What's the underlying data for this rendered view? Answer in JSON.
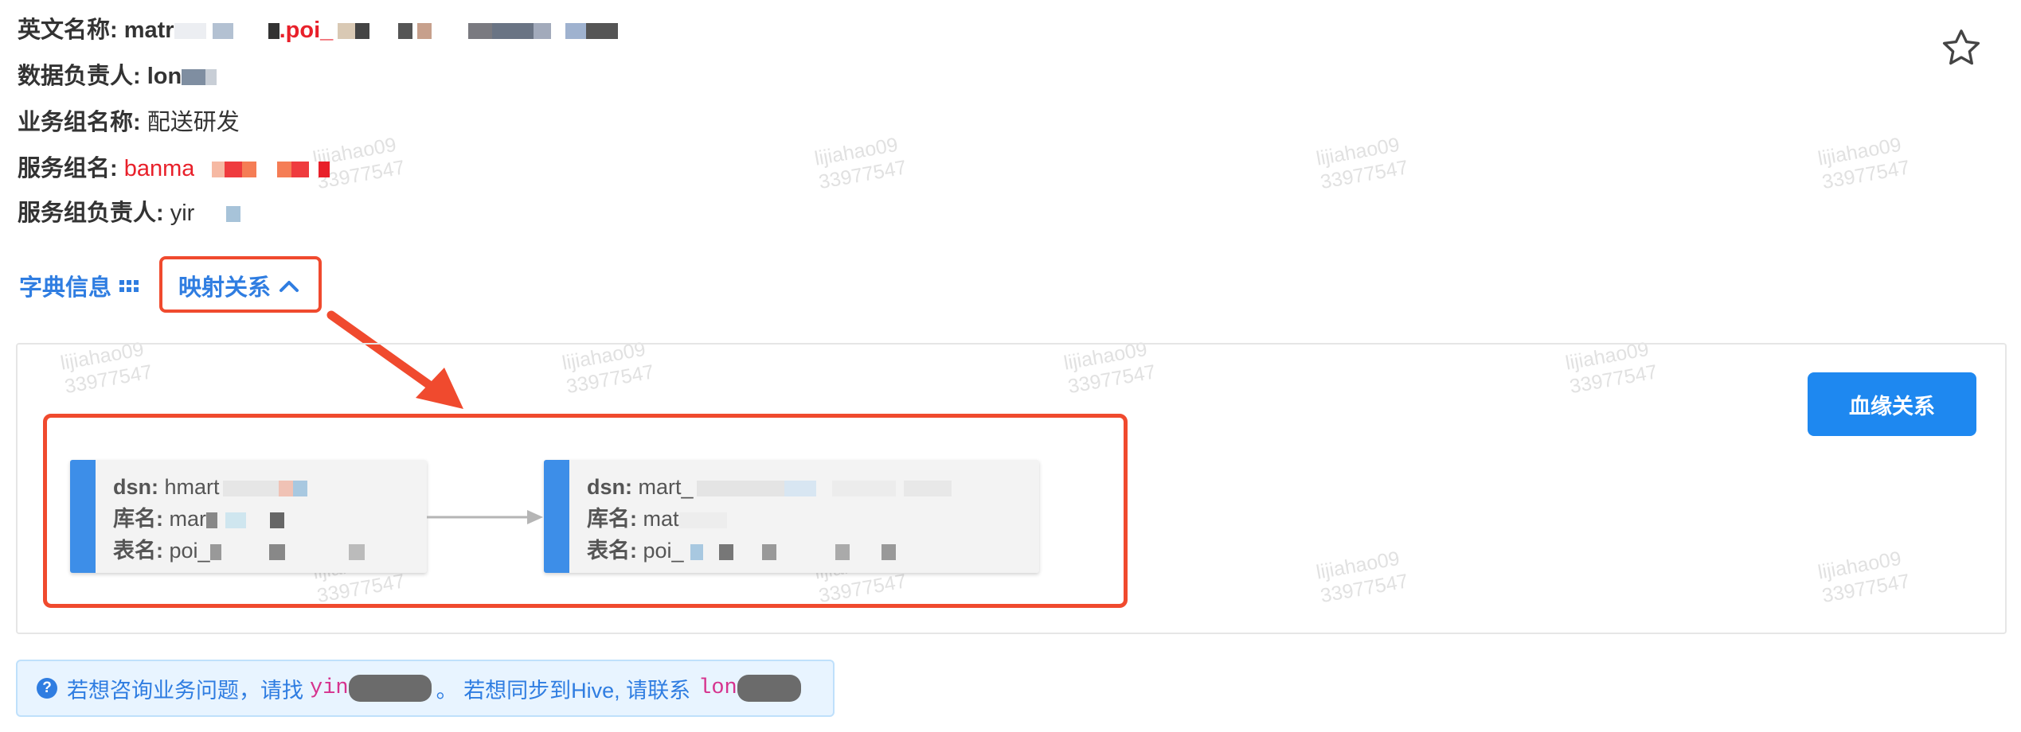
{
  "info": {
    "english_name_label": "英文名称:",
    "english_name_prefix": "matr",
    "english_name_mid": ".poi_",
    "owner_label": "数据负责人:",
    "owner_value": "lon",
    "biz_group_label": "业务组名称:",
    "biz_group_value": "配送研发",
    "service_group_label": "服务组名:",
    "service_group_value": "banma",
    "service_owner_label": "服务组负责人:",
    "service_owner_value": "yir"
  },
  "tabs": {
    "dict_label": "字典信息",
    "mapping_label": "映射关系"
  },
  "panel": {
    "lineage_button": "血缘关系",
    "source_node": {
      "dsn_label": "dsn:",
      "dsn_value": "hmart",
      "db_label": "库名:",
      "db_value": "mar",
      "table_label": "表名:",
      "table_value": "poi_"
    },
    "target_node": {
      "dsn_label": "dsn:",
      "dsn_value": "mart_",
      "db_label": "库名:",
      "db_value": "mat",
      "table_label": "表名:",
      "table_value": "poi_"
    }
  },
  "hint": {
    "text1": "若想咨询业务问题，请找",
    "contact1": "yin",
    "text2": "。 若想同步到Hive, 请联系",
    "contact2": "lon"
  },
  "watermark": {
    "line1": "lijiahao09",
    "line2": "33977547"
  },
  "colors": {
    "accent": "#2f7de1",
    "annotation_red": "#f04a2e",
    "node_bar": "#3d8ee8",
    "button": "#1e88f0",
    "alert_bg": "#e8f4ff"
  },
  "icons": [
    "star-icon",
    "grid-icon",
    "chevron-up-icon",
    "question-icon"
  ]
}
